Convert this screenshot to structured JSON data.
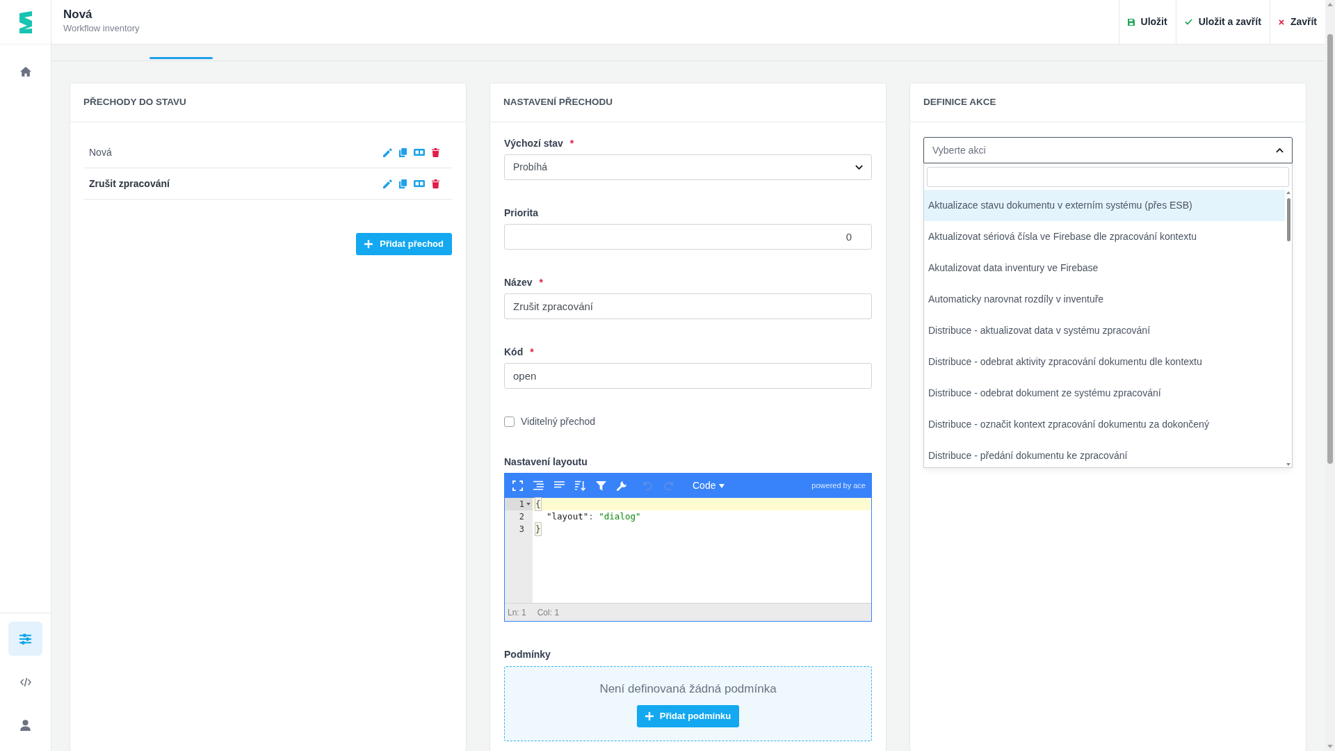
{
  "sidebar": {
    "top_items": [
      {
        "kind": "home",
        "selected": false
      }
    ],
    "bottom_items": [
      {
        "kind": "sliders",
        "selected": true
      },
      {
        "kind": "code",
        "selected": false
      },
      {
        "kind": "user",
        "selected": false
      }
    ]
  },
  "header": {
    "title": "Nová",
    "subtitle": "Workflow inventory",
    "actions": [
      {
        "kind": "save",
        "label": "Uložit"
      },
      {
        "kind": "save_close",
        "label": "Uložit a zavřít"
      },
      {
        "kind": "close",
        "label": "Zavřít"
      }
    ]
  },
  "transitions_panel": {
    "title": "PŘECHODY DO STAVU",
    "items": [
      {
        "label": "Nová",
        "selected": false
      },
      {
        "label": "Zrušit zpracování",
        "selected": true
      }
    ],
    "add_button": "Přidat přechod"
  },
  "settings_panel": {
    "title": "NASTAVENÍ PŘECHODU",
    "fields": [
      {
        "kind": "select",
        "label": "Výchozí stav",
        "required_mark": "*",
        "value": "Probíhá"
      },
      {
        "kind": "number",
        "label": "Priorita",
        "value": "0"
      },
      {
        "kind": "text",
        "label": "Název",
        "required_mark": "*",
        "value": "Zrušit zpracování"
      },
      {
        "kind": "text",
        "label": "Kód",
        "required_mark": "*",
        "value": "open"
      }
    ],
    "visible_checkbox": {
      "label": "Viditelný přechod",
      "checked": false
    },
    "layout_editor": {
      "label": "Nastavení layoutu",
      "toolbar": [
        {
          "kind": "fullscreen",
          "disabled": false
        },
        {
          "kind": "format",
          "disabled": false
        },
        {
          "kind": "compact",
          "disabled": false
        },
        {
          "kind": "sort",
          "disabled": false
        },
        {
          "kind": "filter",
          "disabled": false
        },
        {
          "kind": "repair",
          "disabled": false
        },
        {
          "kind": "undo",
          "disabled": true
        },
        {
          "kind": "redo",
          "disabled": true
        }
      ],
      "mode_menu": "Code",
      "branding": "powered by ace",
      "lines": [
        {
          "number": "1",
          "current": true,
          "foldable": true,
          "indented": false,
          "tokens": [
            {
              "kind": "bracket",
              "text": "{"
            }
          ]
        },
        {
          "number": "2",
          "current": false,
          "foldable": false,
          "indented": true,
          "tokens": [
            {
              "kind": "key",
              "text": "\"layout\""
            },
            {
              "kind": "punct",
              "text": ": "
            },
            {
              "kind": "string",
              "text": "\"dialog\""
            }
          ]
        },
        {
          "number": "3",
          "current": false,
          "foldable": false,
          "indented": false,
          "tokens": [
            {
              "kind": "bracket",
              "text": "}"
            }
          ]
        }
      ],
      "status": [
        "Ln: 1",
        "Col: 1"
      ]
    },
    "conditions": {
      "label": "Podmínky",
      "empty_text": "Není definovaná žádná podmínka",
      "add_button": "Přidat podmínku"
    }
  },
  "action_panel": {
    "title": "DEFINICE AKCE",
    "select": {
      "placeholder": "Vyberte akci",
      "expanded": true,
      "options": [
        {
          "label": "Aktualizace stavu dokumentu v externím systému (přes ESB)",
          "highlighted": true
        },
        {
          "label": "Aktualizovat sériová čísla ve Firebase dle zpracování kontextu",
          "highlighted": false
        },
        {
          "label": "Akutalizovat data inventury ve Firebase",
          "highlighted": false
        },
        {
          "label": "Automaticky narovnat rozdíly v inventuře",
          "highlighted": false
        },
        {
          "label": "Distribuce - aktualizovat data v systému zpracování",
          "highlighted": false
        },
        {
          "label": "Distribuce - odebrat aktivity zpracování dokumentu dle kontextu",
          "highlighted": false
        },
        {
          "label": "Distribuce - odebrat dokument ze systému zpracování",
          "highlighted": false
        },
        {
          "label": "Distribuce - označit kontext zpracování dokumentu za dokončený",
          "highlighted": false
        },
        {
          "label": "Distribuce - předání dokumentu ke zpracování",
          "highlighted": false
        }
      ]
    }
  }
}
